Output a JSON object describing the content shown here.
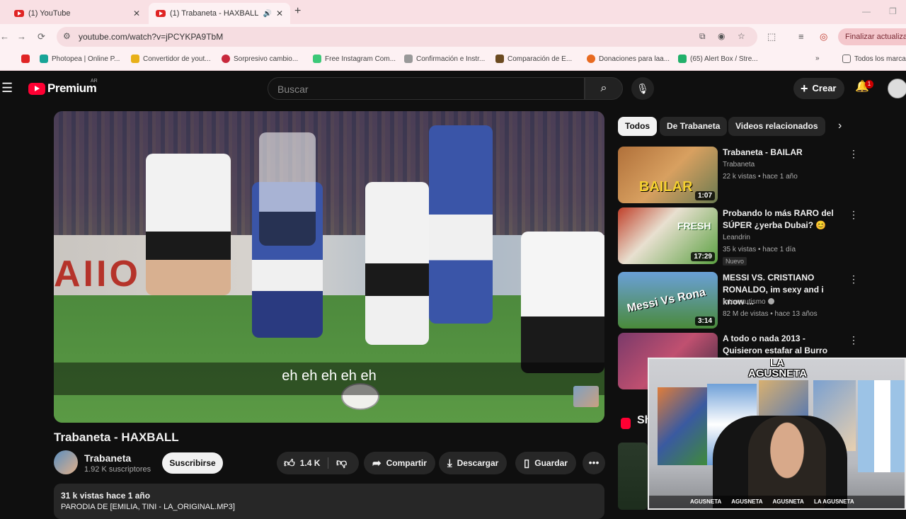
{
  "browser": {
    "tabs": [
      {
        "title": "(1) YouTube"
      },
      {
        "title": "(1) Trabaneta - HAXBALL - Y"
      }
    ],
    "url": "youtube.com/watch?v=jPCYKPA9TbM",
    "update_button": "Finalizar actualización",
    "bookmarks": [
      {
        "label": "Photopea | Online P..."
      },
      {
        "label": "Convertidor de yout..."
      },
      {
        "label": "Sorpresivo cambio..."
      },
      {
        "label": "Free Instagram Com..."
      },
      {
        "label": "Confirmación e Instr..."
      },
      {
        "label": "Comparación de E..."
      },
      {
        "label": "Donaciones para laa..."
      },
      {
        "label": "(65) Alert Box / Stre..."
      }
    ],
    "all_bookmarks": "Todos los marcadores"
  },
  "youtube": {
    "logo_text": "Premium",
    "logo_country": "AR",
    "search_placeholder": "Buscar",
    "create_label": "Crear",
    "notifications_count": "1"
  },
  "video": {
    "subtitle": "eh eh eh eh eh",
    "banner_text": "AIIO",
    "title": "Trabaneta - HAXBALL",
    "channel": "Trabaneta",
    "subscribers": "1.92 K suscriptores",
    "subscribe_label": "Suscribirse",
    "likes": "1.4 K",
    "share_label": "Compartir",
    "download_label": "Descargar",
    "save_label": "Guardar",
    "desc_line1": "31 k vistas  hace 1 año",
    "desc_line2": "PARODIA DE [EMILIA, TINI - LA_ORIGINAL.MP3]"
  },
  "chips": [
    "Todos",
    "De Trabaneta",
    "Videos relacionados"
  ],
  "recommendations": [
    {
      "title": "Trabaneta - BAILAR",
      "channel": "Trabaneta",
      "meta": "22 k vistas • hace 1 año",
      "duration": "1:07",
      "thumb_text": "BAILAR",
      "badge": ""
    },
    {
      "title": "Probando lo más RARO del SÚPER ¿yerba Dubai? 😊",
      "channel": "Leandrin",
      "meta": "35 k vistas • hace 1 día",
      "duration": "17:29",
      "thumb_text": "FRESH",
      "badge": "Nuevo"
    },
    {
      "title": "MESSI VS. CRISTIANO RONALDO, im sexy and i know ...",
      "channel": "Internautismo",
      "meta": "82 M de vistas • hace 13 años",
      "duration": "3:14",
      "thumb_text": "Messi Vs Rona",
      "badge": ""
    },
    {
      "title": "A todo o nada 2013 - Quisieron estafar al Burro Azcka",
      "channel": "",
      "meta": "",
      "duration": "",
      "thumb_text": "",
      "badge": ""
    }
  ],
  "shorts_peek": "Sh",
  "webcam": {
    "logo": "LA AGUSNETA",
    "socials": [
      "AGUSNETA",
      "AGUSNETA",
      "AGUSNETA",
      "LA AGUSNETA"
    ]
  },
  "colors": {
    "accent": "#ff0033",
    "bg": "#0f0f0f",
    "chrome": "#fdf1f3"
  }
}
